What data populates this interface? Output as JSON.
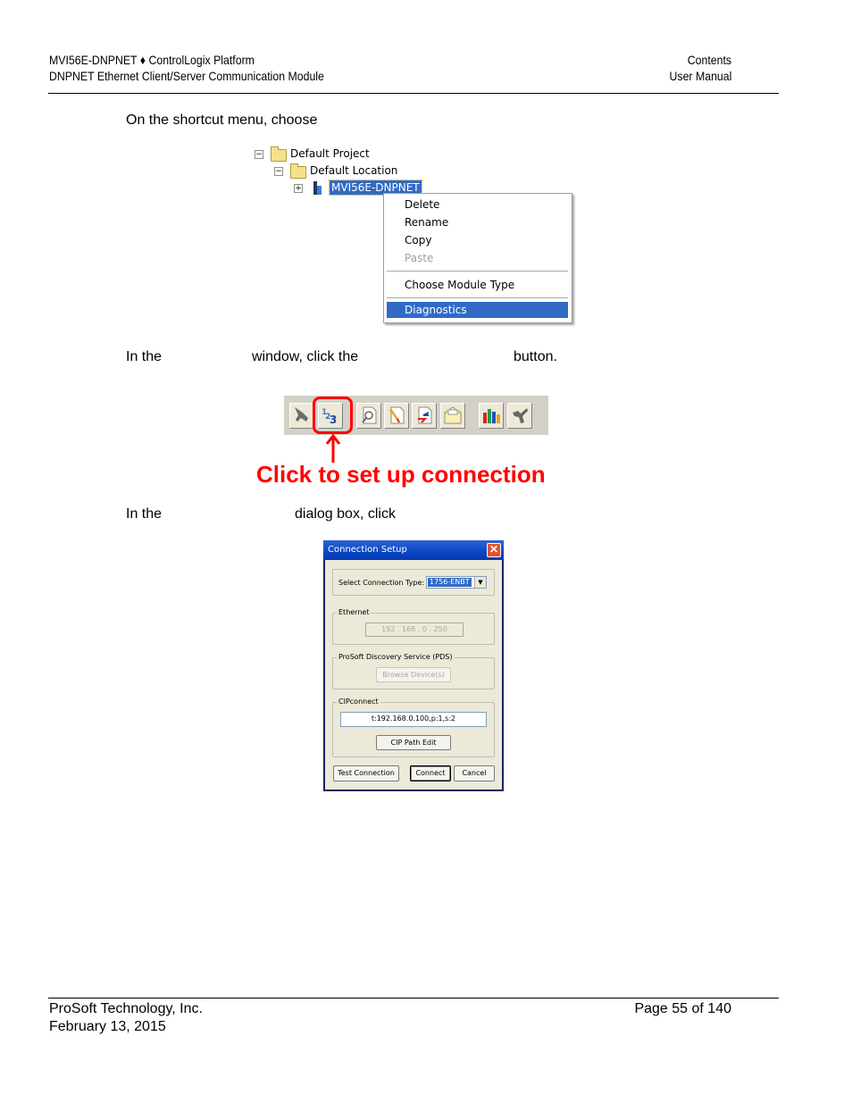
{
  "header": {
    "left_line1": "MVI56E-DNPNET ♦ ControlLogix Platform",
    "left_line2": "DNPNET Ethernet Client/Server Communication Module",
    "right_line1": "Contents",
    "right_line2": "User Manual"
  },
  "steps": {
    "step1": "On the shortcut menu, choose",
    "step2_a": "In the",
    "step2_b": "window, click the",
    "step2_c": "button.",
    "step3_a": "In the",
    "step3_b": "dialog box, click"
  },
  "tree": {
    "nodes": [
      {
        "label": "Default Project",
        "expander": "−",
        "icon": "folder-icon"
      },
      {
        "label": "Default Location",
        "expander": "−",
        "icon": "location-folder-icon"
      },
      {
        "label": "MVI56E-DNPNET",
        "expander": "+",
        "icon": "module-icon",
        "selected": true
      }
    ]
  },
  "context_menu": {
    "items": [
      {
        "label": "Delete",
        "enabled": true
      },
      {
        "label": "Rename",
        "enabled": true
      },
      {
        "label": "Copy",
        "enabled": true
      },
      {
        "label": "Paste",
        "enabled": false
      },
      {
        "label": "Choose Module Type",
        "enabled": true
      },
      {
        "label": "Diagnostics",
        "enabled": true,
        "highlighted": true
      }
    ]
  },
  "toolbar": {
    "buttons": [
      {
        "icon": "disconnect-plug-icon"
      },
      {
        "icon": "setup-connection-icon",
        "highlighted": true
      },
      {
        "icon": "find-document-icon"
      },
      {
        "icon": "edit-document-icon"
      },
      {
        "icon": "transfer-document-icon"
      },
      {
        "icon": "mail-icon"
      },
      {
        "icon": "bar-chart-icon"
      },
      {
        "icon": "tool-icon"
      }
    ],
    "callout": "Click to set up connection",
    "callout_color": "#ff0000"
  },
  "dialog": {
    "title": "Connection Setup",
    "connection_type_label": "Select Connection Type:",
    "connection_type_value": "1756-ENBT",
    "ethernet_group": "Ethernet",
    "ethernet_ip": "192 . 168 .  0  . 250",
    "pds_group": "ProSoft Discovery Service (PDS)",
    "browse_button": "Browse Device(s)",
    "cipconnect_group": "CIPconnect",
    "cip_path": "t:192.168.0.100,p:1,s:2",
    "cip_path_edit_button": "CIP Path Edit",
    "test_connection_button": "Test Connection",
    "connect_button": "Connect",
    "cancel_button": "Cancel"
  },
  "footer": {
    "company": "ProSoft Technology, Inc.",
    "date": "February 13, 2015",
    "page": "Page 55 of 140"
  }
}
